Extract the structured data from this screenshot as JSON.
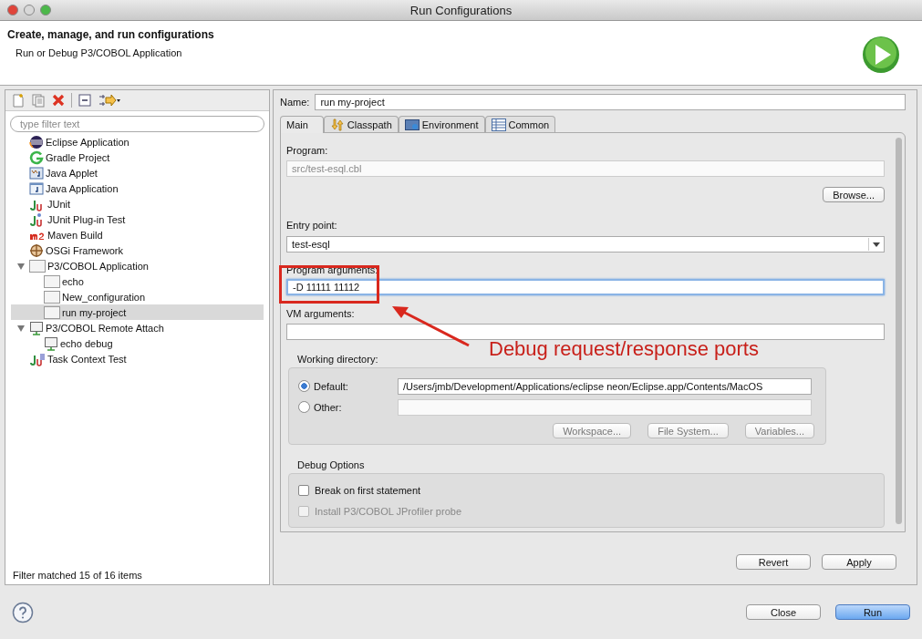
{
  "window": {
    "title": "Run Configurations"
  },
  "header": {
    "title": "Create, manage, and run configurations",
    "subtitle": "Run or Debug P3/COBOL Application"
  },
  "filter": {
    "placeholder": "type filter text"
  },
  "tree": [
    {
      "label": "Eclipse Application",
      "kind": "eclipse",
      "selected": false
    },
    {
      "label": "Gradle Project",
      "kind": "gradle",
      "selected": false
    },
    {
      "label": "Java Applet",
      "kind": "applet",
      "selected": false
    },
    {
      "label": "Java Application",
      "kind": "java",
      "selected": false
    },
    {
      "label": "JUnit",
      "kind": "junit",
      "selected": false
    },
    {
      "label": "JUnit Plug-in Test",
      "kind": "plugin",
      "selected": false
    },
    {
      "label": "Maven Build",
      "kind": "maven",
      "selected": false
    },
    {
      "label": "OSGi Framework",
      "kind": "osgi",
      "selected": false
    },
    {
      "label": "P3/COBOL Application",
      "kind": "cobol",
      "selected": false,
      "expanded": true,
      "children": [
        {
          "label": "echo",
          "kind": "cobol",
          "selected": false
        },
        {
          "label": "New_configuration",
          "kind": "cobol",
          "selected": false
        },
        {
          "label": "run my-project",
          "kind": "cobol",
          "selected": true
        }
      ]
    },
    {
      "label": "P3/COBOL Remote Attach",
      "kind": "remote",
      "selected": false,
      "expanded": true,
      "children": [
        {
          "label": "echo debug",
          "kind": "remote",
          "selected": false
        }
      ]
    },
    {
      "label": "Task Context Test",
      "kind": "task",
      "selected": false
    }
  ],
  "filter_status": "Filter matched 15 of 16 items",
  "name": {
    "label": "Name:",
    "value": "run my-project"
  },
  "tabs": [
    {
      "label": "Main",
      "kind": "main",
      "selected": true
    },
    {
      "label": "Classpath",
      "kind": "classpath",
      "selected": false
    },
    {
      "label": "Environment",
      "kind": "environment",
      "selected": false
    },
    {
      "label": "Common",
      "kind": "common",
      "selected": false
    }
  ],
  "program": {
    "label": "Program:",
    "value": "src/test-esql.cbl",
    "disabled": true
  },
  "browse_button": "Browse...",
  "entry_point": {
    "label": "Entry point:",
    "value": "test-esql"
  },
  "program_arguments": {
    "label": "Program arguments:",
    "value": "-D 11111 11112"
  },
  "vm_arguments": {
    "label": "VM arguments:"
  },
  "working_directory": {
    "label": "Working directory:",
    "options": [
      {
        "label": "Default:",
        "selected": true,
        "value": "/Users/jmb/Development/Applications/eclipse neon/Eclipse.app/Contents/MacOS"
      },
      {
        "label": "Other:",
        "selected": false
      }
    ],
    "buttons": [
      {
        "label": "Workspace...",
        "disabled": true
      },
      {
        "label": "File System...",
        "disabled": true
      },
      {
        "label": "Variables...",
        "disabled": true
      }
    ]
  },
  "debug_options": {
    "label": "Debug Options",
    "checks": [
      {
        "label": "Break on first statement",
        "checked": false,
        "disabled": false
      },
      {
        "label": "Install P3/COBOL JProfiler probe",
        "checked": false,
        "disabled": true
      }
    ]
  },
  "annotation": {
    "text": "Debug request/response ports"
  },
  "panel_buttons": [
    "Revert",
    "Apply"
  ],
  "dialog_buttons": [
    {
      "label": "Close",
      "default": false
    },
    {
      "label": "Run",
      "default": true
    }
  ]
}
